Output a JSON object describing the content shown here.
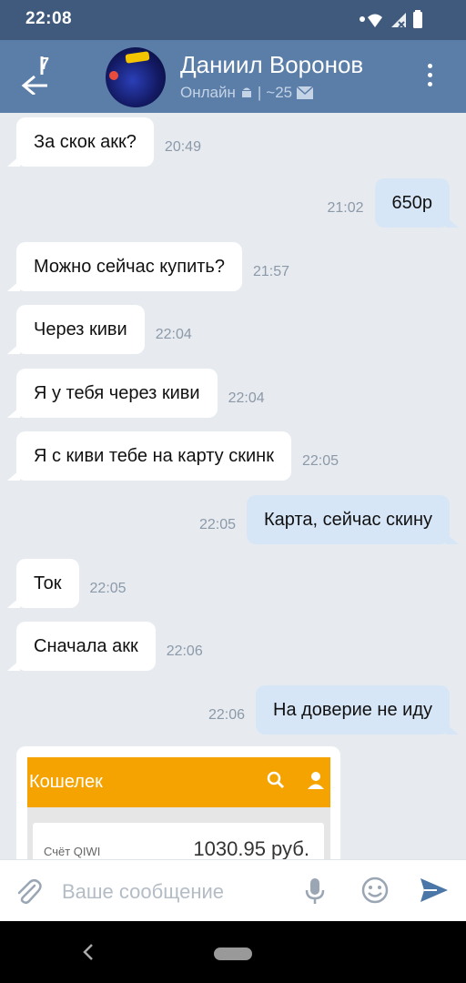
{
  "status": {
    "time": "22:08"
  },
  "header": {
    "back_badge": "7",
    "contact_name": "Даниил Воронов",
    "status_text": "Онлайн",
    "separator": "|",
    "message_count": "~25"
  },
  "messages": [
    {
      "dir": "in",
      "text": "За скок акк?",
      "time": "20:49"
    },
    {
      "dir": "out",
      "text": "650р",
      "time": "21:02"
    },
    {
      "dir": "in",
      "text": "Можно сейчас купить?",
      "time": "21:57"
    },
    {
      "dir": "in",
      "text": "Через киви",
      "time": "22:04"
    },
    {
      "dir": "in",
      "text": "Я у тебя через киви",
      "time": "22:04"
    },
    {
      "dir": "in",
      "text": "Я с киви тебе на карту скинк",
      "time": "22:05"
    },
    {
      "dir": "out",
      "text": "Карта, сейчас скину",
      "time": "22:05"
    },
    {
      "dir": "in",
      "text": "Ток",
      "time": "22:05"
    },
    {
      "dir": "in",
      "text": "Сначала акк",
      "time": "22:06"
    },
    {
      "dir": "out",
      "text": "На доверие не иду",
      "time": "22:06"
    }
  ],
  "attachment": {
    "wallet_title": "Кошелек",
    "account_label": "Счёт QIWI",
    "balance": "1030.95 руб."
  },
  "composer": {
    "placeholder": "Ваше сообщение"
  },
  "colors": {
    "header": "#5b7ea8",
    "statusbar": "#3f5a7c",
    "incoming": "#ffffff",
    "outgoing": "#d7e6f7",
    "accent": "#4a76a8",
    "qiwi": "#f5a300"
  }
}
